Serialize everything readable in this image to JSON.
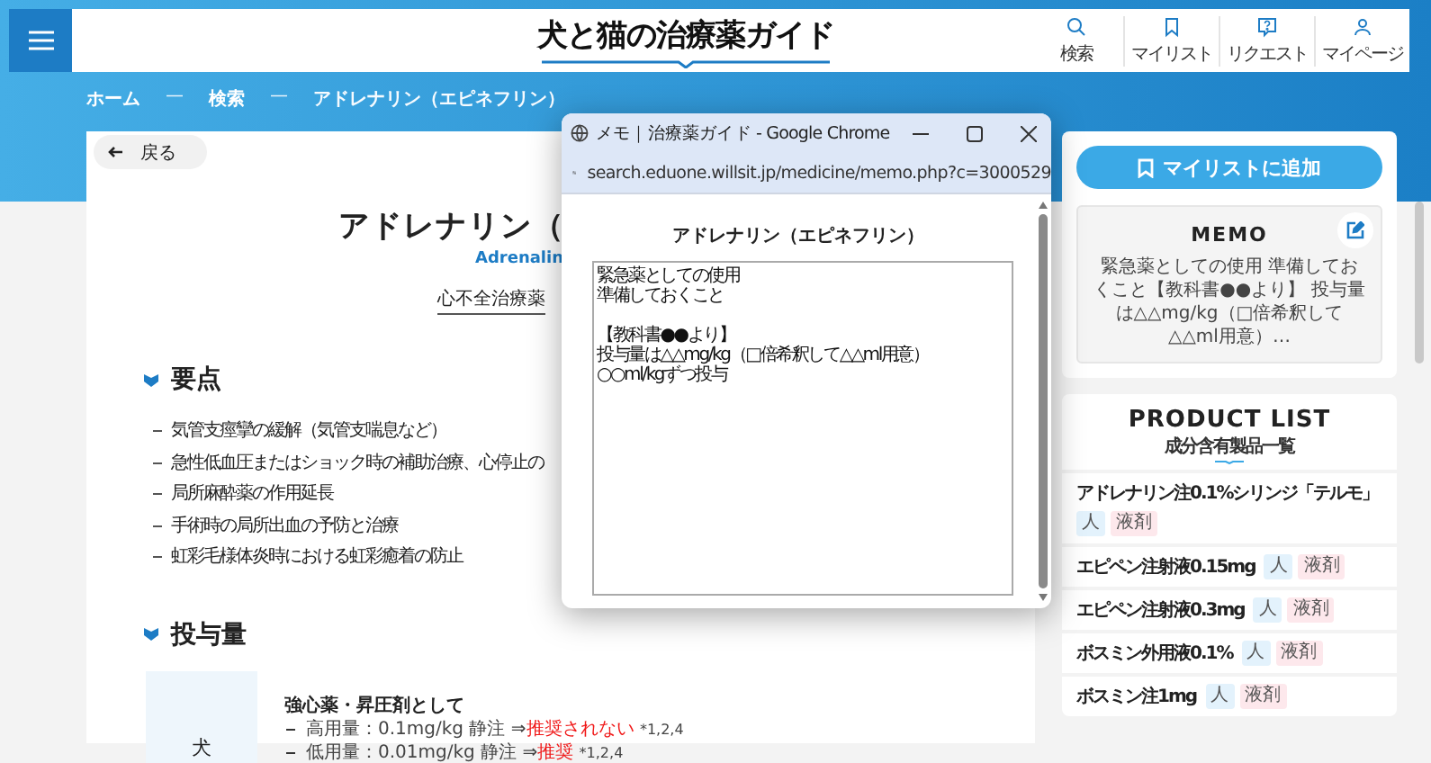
{
  "header": {
    "logo": "犬と猫の治療薬ガイド",
    "nav": [
      {
        "label": "検索"
      },
      {
        "label": "マイリスト"
      },
      {
        "label": "リクエスト"
      },
      {
        "label": "マイページ"
      }
    ]
  },
  "breadcrumb": [
    {
      "kind": "link",
      "text": "ホーム"
    },
    {
      "kind": "separator",
      "text": "—"
    },
    {
      "kind": "link",
      "text": "検索"
    },
    {
      "kind": "separator",
      "text": "—"
    },
    {
      "kind": "current",
      "text": "アドレナリン（エピネフリン）"
    }
  ],
  "main": {
    "back_button": "戻る",
    "title": "アドレナリン（",
    "subtitle": "Adrenalin",
    "category": "心不全治療薬",
    "sections": [
      {
        "kind": "list",
        "heading": "要点",
        "items": [
          "気管支痙攣の緩解（気管支喘息など）",
          "急性低血圧またはショック時の補助治療、心停止の",
          "局所麻酔薬の作用延長",
          "手術時の局所出血の予防と治療",
          "虹彩毛様体炎時における虹彩癒着の防止"
        ]
      },
      {
        "kind": "dosage",
        "heading": "投与量",
        "species": "犬",
        "group_title": "強心薬・昇圧剤として",
        "lines": [
          {
            "text": "高用量：0.1mg/kg 静注 ⇒",
            "verdict": "推奨されない",
            "refs": "*1,2,4"
          },
          {
            "text": "低用量：0.01mg/kg 静注 ⇒",
            "verdict": "推奨",
            "refs": "*1,2,4"
          }
        ]
      }
    ]
  },
  "sidebar": {
    "add_button": "マイリストに追加",
    "memo": {
      "title": "MEMO",
      "text": "緊急薬としての使用 準備しておくこと【教科書●●より】 投与量は△△mg/kg（□倍希釈して△△ml用意）…"
    },
    "product_list": {
      "title": "PRODUCT LIST",
      "subtitle": "成分含有製品一覧",
      "items": [
        {
          "name": "アドレナリン注0.1%シリンジ「テルモ」",
          "tags": [
            {
              "text": "人",
              "color": "#e3f2fc"
            },
            {
              "text": "液剤",
              "color": "#fde8ec"
            }
          ]
        },
        {
          "name": "エピペン注射液0.15mg",
          "tags": [
            {
              "text": "人",
              "color": "#e3f2fc"
            },
            {
              "text": "液剤",
              "color": "#fde8ec"
            }
          ]
        },
        {
          "name": "エピペン注射液0.3mg",
          "tags": [
            {
              "text": "人",
              "color": "#e3f2fc"
            },
            {
              "text": "液剤",
              "color": "#fde8ec"
            }
          ]
        },
        {
          "name": "ボスミン外用液0.1%",
          "tags": [
            {
              "text": "人",
              "color": "#e3f2fc"
            },
            {
              "text": "液剤",
              "color": "#fde8ec"
            }
          ]
        },
        {
          "name": "ボスミン注1mg",
          "tags": [
            {
              "text": "人",
              "color": "#e3f2fc"
            },
            {
              "text": "液剤",
              "color": "#fde8ec"
            }
          ]
        }
      ]
    }
  },
  "memo_window": {
    "title": "メモ｜治療薬ガイド - Google Chrome",
    "url": "search.eduone.willsit.jp/medicine/memo.php?c=3000529",
    "heading": "アドレナリン（エピネフリン）",
    "memo_paragraphs": [
      [
        "緊急薬としての使用",
        "準備しておくこと"
      ],
      [
        "【教科書●●より】",
        "投与量は△△mg/kg（□倍希釈して△△ml用意）",
        "○○ml/kgずつ投与"
      ]
    ]
  }
}
